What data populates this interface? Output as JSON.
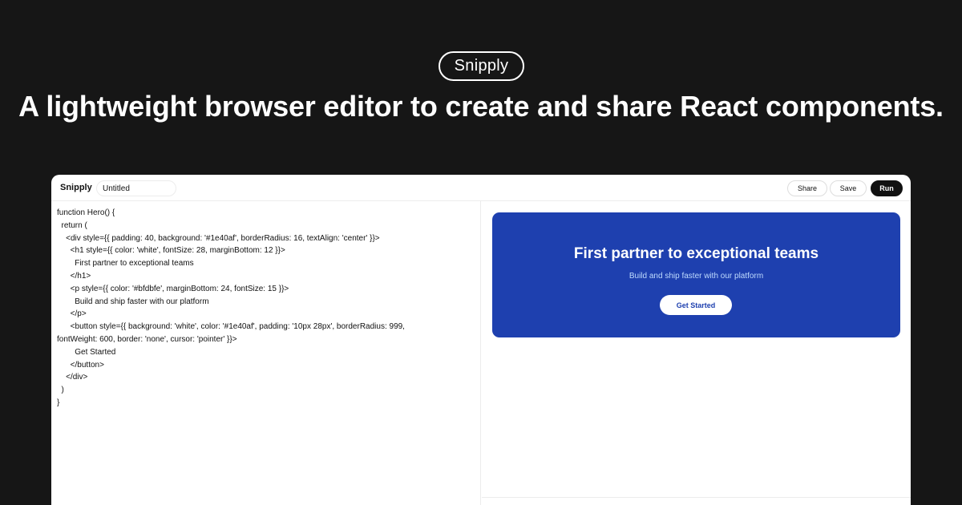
{
  "banner": {
    "badge": "Snipply",
    "headline": "A lightweight browser editor to create and share React components."
  },
  "editor": {
    "brand": "Snipply",
    "title_value": "Untitled",
    "actions": {
      "share": "Share",
      "save": "Save",
      "run": "Run"
    },
    "code_lines": [
      "function Hero() {",
      "  return (",
      "    <div style={{ padding: 40, background: '#1e40af', borderRadius: 16, textAlign: 'center' }}>",
      "      <h1 style={{ color: 'white', fontSize: 28, marginBottom: 12 }}>",
      "        First partner to exceptional teams",
      "      </h1>",
      "      <p style={{ color: '#bfdbfe', marginBottom: 24, fontSize: 15 }}>",
      "        Build and ship faster with our platform",
      "      </p>",
      "      <button style={{ background: 'white', color: '#1e40af', padding: '10px 28px', borderRadius: 999,",
      "fontWeight: 600, border: 'none', cursor: 'pointer' }}>",
      "        Get Started",
      "      </button>",
      "    </div>",
      "  )",
      "}"
    ]
  },
  "preview": {
    "hero_title": "First partner to exceptional teams",
    "hero_subtitle": "Build and ship faster with our platform",
    "hero_button": "Get Started",
    "hero_bg": "#1e40af",
    "hero_sub_color": "#bfdbfe"
  }
}
